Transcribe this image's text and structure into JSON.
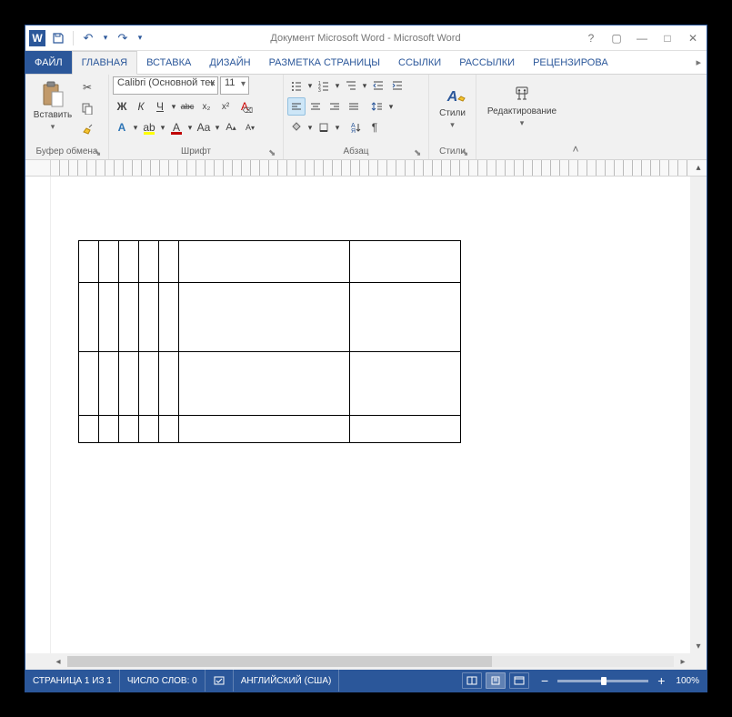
{
  "title": "Документ Microsoft Word - Microsoft Word",
  "tabs": {
    "file": "ФАЙЛ",
    "home": "ГЛАВНАЯ",
    "insert": "ВСТАВКА",
    "design": "ДИЗАЙН",
    "layout": "РАЗМЕТКА СТРАНИЦЫ",
    "references": "ССЫЛКИ",
    "mailings": "РАССЫЛКИ",
    "review": "РЕЦЕНЗИРОВА"
  },
  "ribbon": {
    "clipboard": {
      "label": "Буфер обмена",
      "paste": "Вставить"
    },
    "font": {
      "label": "Шрифт",
      "name": "Calibri (Основной тек",
      "size": "11"
    },
    "paragraph": {
      "label": "Абзац"
    },
    "styles": {
      "label": "Стили",
      "btn": "Стили"
    },
    "editing": {
      "label": "",
      "btn": "Редактирование"
    }
  },
  "icons": {
    "word": "W",
    "bold": "Ж",
    "italic": "К",
    "underline": "Ч",
    "strike": "abc",
    "sub": "x₂",
    "sup": "x²",
    "clear": "A",
    "grow": "A",
    "shrink": "A",
    "case": "Aa",
    "highlight": "ab",
    "fontcolor": "A",
    "effects": "A"
  },
  "status": {
    "page": "СТРАНИЦА 1 ИЗ 1",
    "words": "ЧИСЛО СЛОВ: 0",
    "lang": "АНГЛИЙСКИЙ (США)",
    "zoom": "100%"
  },
  "table": {
    "rows": 4,
    "cols": 7
  }
}
